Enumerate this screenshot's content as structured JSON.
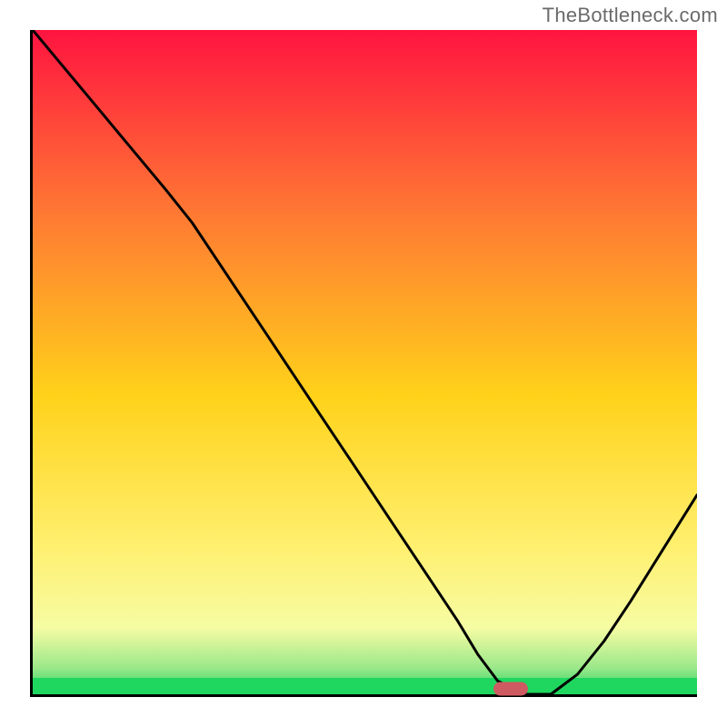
{
  "watermark": "TheBottleneck.com",
  "colors": {
    "top": "#ff1440",
    "upper_mid": "#ff7a33",
    "mid": "#ffd21a",
    "lower_mid": "#fff070",
    "pale": "#f6fca3",
    "green_band": "#9be88a",
    "base": "#1fd65f",
    "marker": "#cf5b62",
    "line": "#000000"
  },
  "chart_data": {
    "type": "line",
    "title": "",
    "xlabel": "",
    "ylabel": "",
    "xlim": [
      0,
      100
    ],
    "ylim": [
      0,
      100
    ],
    "x": [
      0,
      5,
      10,
      15,
      20,
      24,
      30,
      36,
      42,
      48,
      54,
      60,
      64,
      67,
      70,
      74,
      78,
      82,
      86,
      90,
      95,
      100
    ],
    "y": [
      100,
      94,
      88,
      82,
      76,
      71,
      62,
      53,
      44,
      35,
      26,
      17,
      11,
      6,
      2,
      0,
      0,
      3,
      8,
      14,
      22,
      30
    ],
    "marker": {
      "x": 72,
      "y": 0.8
    },
    "green_band_y": 2.5
  }
}
